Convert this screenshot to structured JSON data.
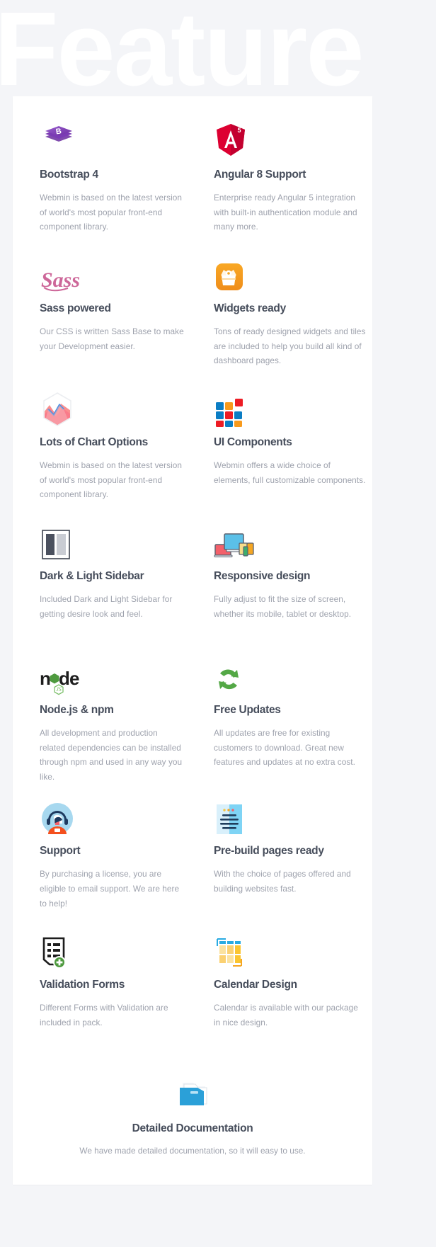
{
  "background": {
    "watermark_text": "Feature",
    "page_bg": "#f4f5f8",
    "card_bg": "#ffffff",
    "title_color": "#464d5b",
    "desc_color": "#9ea2ad"
  },
  "features": [
    {
      "icon": "bootstrap-icon",
      "title": "Bootstrap 4",
      "desc": "Webmin is based on the latest version of world's most popular front-end component library."
    },
    {
      "icon": "angular-icon",
      "title": "Angular 8 Support",
      "desc": "Enterprise ready Angular 5 integration with built-in authentication module and many more."
    },
    {
      "icon": "sass-icon",
      "title": "Sass powered",
      "desc": "Our CSS is written Sass Base to make your Development easier."
    },
    {
      "icon": "widgets-icon",
      "title": "Widgets ready",
      "desc": "Tons of ready designed widgets and tiles are included to help you build all kind of dashboard pages."
    },
    {
      "icon": "chart-hexagon-icon",
      "title": "Lots of Chart Options",
      "desc": "Webmin is based on the latest version of world's most popular front-end component library."
    },
    {
      "icon": "ui-components-grid-icon",
      "title": "UI Components",
      "desc": "Webmin offers a wide choice of elements, full customizable components."
    },
    {
      "icon": "sidebar-theme-icon",
      "title": "Dark & Light Sidebar",
      "desc": "Included Dark and Light Sidebar for getting desire look and feel."
    },
    {
      "icon": "responsive-devices-icon",
      "title": "Responsive design",
      "desc": "Fully adjust to fit the size of screen, whether its mobile, tablet or desktop."
    },
    {
      "icon": "nodejs-icon",
      "title": "Node.js & npm",
      "desc": "All development and production related dependencies can be installed through npm and used in any way you like."
    },
    {
      "icon": "refresh-updates-icon",
      "title": "Free Updates",
      "desc": "All updates are free for existing customers to download. Great new features and updates at no extra cost."
    },
    {
      "icon": "headset-support-icon",
      "title": "Support",
      "desc": "By purchasing a license, you are eligible to email support. We are here to help!"
    },
    {
      "icon": "document-pages-icon",
      "title": "Pre-build pages ready",
      "desc": "With the choice of pages offered and building websites fast."
    },
    {
      "icon": "form-validation-icon",
      "title": "Validation Forms",
      "desc": "Different Forms with Validation are included in pack."
    },
    {
      "icon": "calendar-icon",
      "title": "Calendar Design",
      "desc": "Calendar is available with our package in nice design."
    }
  ],
  "footer": {
    "icon": "folder-icon",
    "title": "Detailed Documentation",
    "desc": "We have made detailed documentation, so it will easy to use."
  },
  "colors": {
    "bootstrap_purple": "#7952b3",
    "angular_red": "#dd0031",
    "sass_pink": "#cd6799",
    "widgets_orange": "#f5a623",
    "ui_blue": "#0b7dc4",
    "ui_orange": "#f89a1c",
    "ui_red": "#ed1c24",
    "node_green": "#68a063",
    "updates_green": "#54a846",
    "support_blue": "#a7d8ef",
    "calendar_yellow": "#fbc531",
    "folder_blue": "#2196cd"
  }
}
